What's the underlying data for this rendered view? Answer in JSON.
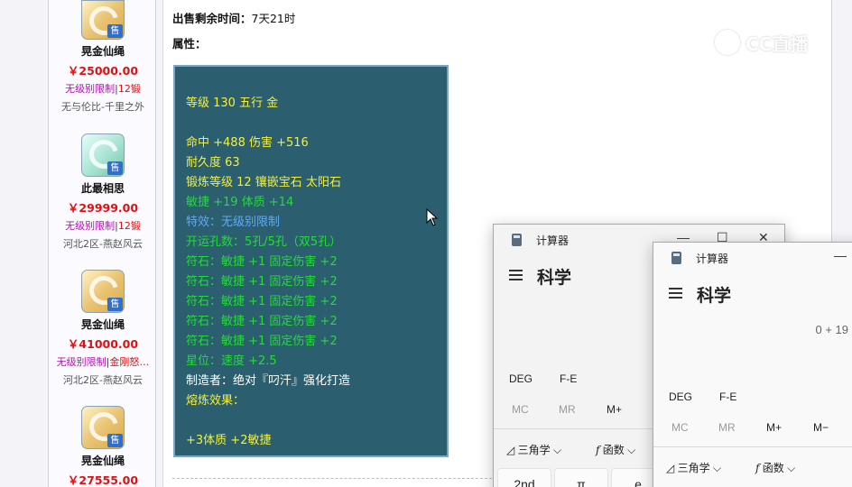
{
  "listings": [
    {
      "name": "晃金仙绳",
      "price": "￥25000.00",
      "tag1": "无级别限制",
      "sep": "|",
      "tag2": "12锻",
      "seller": "无与伦比-千里之外",
      "badge": "售",
      "icon": "rope-item-icon"
    },
    {
      "name": "此最相思",
      "price": "￥29999.00",
      "tag1": "无级别限制",
      "sep": "|",
      "tag2": "12锻",
      "seller": "河北2区-燕赵风云",
      "badge": "售",
      "icon": "jade-item-icon"
    },
    {
      "name": "晃金仙绳",
      "price": "￥41000.00",
      "tag1": "无级别限制",
      "sep": "|",
      "tag2": "金刚怒…",
      "seller": "河北2区-燕赵风云",
      "badge": "售",
      "icon": "rope-item-icon"
    },
    {
      "name": "晃金仙绳",
      "price": "￥27555.00",
      "tag1": "",
      "sep": "",
      "tag2": "",
      "seller": "",
      "badge": "售",
      "icon": "rope-item-icon"
    }
  ],
  "detail": {
    "remaining_label": "出售剩余时间：",
    "remaining_value": "7天21时",
    "attributes_label": "属性："
  },
  "properties": [
    {
      "text": "",
      "color": "y"
    },
    {
      "text": "等级 130 五行 金",
      "color": "y"
    },
    {
      "text": "",
      "color": "y"
    },
    {
      "text": "命中 +488 伤害 +516",
      "color": "y"
    },
    {
      "text": "耐久度 63",
      "color": "y"
    },
    {
      "text": "锻炼等级 12 镶嵌宝石 太阳石",
      "color": "y"
    },
    {
      "text": "敏捷 +19 体质 +14",
      "color": "g"
    },
    {
      "text": "特效：无级别限制",
      "color": "b"
    },
    {
      "text": "开运孔数：5孔/5孔（双5孔）",
      "color": "g"
    },
    {
      "text": "符石：敏捷 +1 固定伤害 +2",
      "color": "g"
    },
    {
      "text": "符石：敏捷 +1 固定伤害 +2",
      "color": "g"
    },
    {
      "text": "符石：敏捷 +1 固定伤害 +2",
      "color": "g"
    },
    {
      "text": "符石：敏捷 +1 固定伤害 +2",
      "color": "g"
    },
    {
      "text": "符石：敏捷 +1 固定伤害 +2",
      "color": "g"
    },
    {
      "text": "星位：速度 +2.5",
      "color": "g"
    },
    {
      "text": "制造者：绝对『叼汗』强化打造",
      "color": "w"
    },
    {
      "text": "熔炼效果：",
      "color": "y"
    },
    {
      "text": "",
      "color": "y"
    },
    {
      "text": "+3体质 +2敏捷",
      "color": "y"
    }
  ],
  "colors": {
    "y": "#f4ef3a",
    "w": "#ffffff",
    "g": "#22dd33",
    "b": "#61a9f5",
    "box_bg": "#2b5f6f",
    "price": "#e01010"
  },
  "watermark": {
    "text": "CC直播"
  },
  "calc1": {
    "title": "计算器",
    "mode": "科学",
    "deg": "DEG",
    "fe": "F-E",
    "mem": [
      "MC",
      "MR",
      "M+"
    ],
    "trig": "三角学",
    "func": "函数",
    "keys": [
      "2nd",
      "π",
      "e"
    ],
    "min": "—",
    "max": "☐",
    "close": "✕"
  },
  "calc2": {
    "title": "计算器",
    "mode": "科学",
    "expression": "0 + 19",
    "deg": "DEG",
    "fe": "F-E",
    "mem": [
      "MC",
      "MR",
      "M+",
      "M−"
    ],
    "trig": "三角学",
    "func": "函数",
    "min": "—"
  }
}
